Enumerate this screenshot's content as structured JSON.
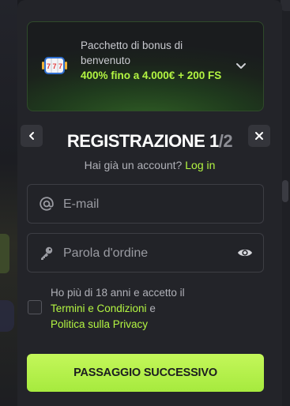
{
  "bonus": {
    "title": "Pacchetto di bonus di benvenuto",
    "offer": "400% fino a 4.000€ + 200 FS",
    "icon": "slot-machine-icon"
  },
  "header": {
    "title": "REGISTRAZIONE",
    "step_current": "1",
    "step_total": "/2",
    "back_icon": "chevron-left-icon",
    "close_icon": "close-icon"
  },
  "login": {
    "prompt": "Hai già un account?",
    "link": "Log in"
  },
  "form": {
    "email_placeholder": "E-mail",
    "email_value": "",
    "password_placeholder": "Parola d'ordine",
    "password_value": "",
    "terms_checked": false,
    "terms_text": "Ho più di 18 anni e accetto il",
    "terms_link": "Termini e Condizioni",
    "terms_and": "e",
    "privacy_link": "Politica sulla Privacy",
    "submit_label": "PASSAGGIO SUCCESSIVO"
  },
  "colors": {
    "accent": "#b3f542",
    "background": "#232429",
    "button": "#b8f24e"
  }
}
